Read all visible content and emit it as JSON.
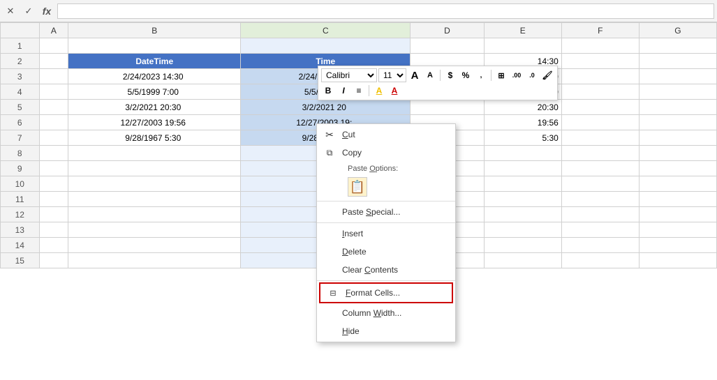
{
  "formulaBar": {
    "cancelLabel": "✕",
    "confirmLabel": "✓",
    "functionLabel": "fx"
  },
  "columns": {
    "headers": [
      "",
      "A",
      "B",
      "C",
      "D",
      "E",
      "F",
      "G"
    ]
  },
  "rows": [
    {
      "num": "1",
      "b": "",
      "c": "",
      "d": "",
      "e": "",
      "f": "",
      "g": ""
    },
    {
      "num": "2",
      "b": "DateTime",
      "c": "Time",
      "d": "",
      "e": "14:30",
      "f": "",
      "g": ""
    },
    {
      "num": "3",
      "b": "2/24/2023 14:30",
      "c": "2/24/2023 14:",
      "d": "",
      "e": "14:30",
      "f": "",
      "g": ""
    },
    {
      "num": "4",
      "b": "5/5/1999 7:00",
      "c": "5/5/1999 7",
      "d": "",
      "e": "7:00",
      "f": "",
      "g": ""
    },
    {
      "num": "5",
      "b": "3/2/2021 20:30",
      "c": "3/2/2021 20",
      "d": "",
      "e": "20:30",
      "f": "",
      "g": ""
    },
    {
      "num": "6",
      "b": "12/27/2003 19:56",
      "c": "12/27/2003 19:",
      "d": "",
      "e": "19:56",
      "f": "",
      "g": ""
    },
    {
      "num": "7",
      "b": "9/28/1967 5:30",
      "c": "9/28/1967 5",
      "d": "",
      "e": "5:30",
      "f": "",
      "g": ""
    },
    {
      "num": "8",
      "b": "",
      "c": "",
      "d": "",
      "e": "",
      "f": "",
      "g": ""
    },
    {
      "num": "9",
      "b": "",
      "c": "",
      "d": "",
      "e": "",
      "f": "",
      "g": ""
    },
    {
      "num": "10",
      "b": "",
      "c": "",
      "d": "",
      "e": "",
      "f": "",
      "g": ""
    },
    {
      "num": "11",
      "b": "",
      "c": "",
      "d": "",
      "e": "",
      "f": "",
      "g": ""
    },
    {
      "num": "12",
      "b": "",
      "c": "",
      "d": "",
      "e": "",
      "f": "",
      "g": ""
    },
    {
      "num": "13",
      "b": "",
      "c": "",
      "d": "",
      "e": "",
      "f": "",
      "g": ""
    },
    {
      "num": "14",
      "b": "",
      "c": "",
      "d": "",
      "e": "",
      "f": "",
      "g": ""
    },
    {
      "num": "15",
      "b": "",
      "c": "",
      "d": "",
      "e": "",
      "f": "",
      "g": ""
    }
  ],
  "miniToolbar": {
    "fontFamily": "Calibri",
    "fontSize": "11",
    "boldLabel": "B",
    "italicLabel": "I",
    "alignLabel": "≡",
    "highlightLabel": "A",
    "fontColorLabel": "A",
    "borderLabel": "⊞",
    "percentLabel": "%",
    "commaLabel": ",",
    "increaseDecimalLabel": "←.0",
    "decreaseDecimalLabel": ".00→",
    "paintLabel": "🖌"
  },
  "contextMenu": {
    "items": [
      {
        "id": "cut",
        "icon": "✂",
        "label": "Cut",
        "underline": 1,
        "disabled": false
      },
      {
        "id": "copy",
        "icon": "⧉",
        "label": "Copy",
        "underline": 0,
        "disabled": false
      },
      {
        "id": "paste-options",
        "icon": "",
        "label": "Paste Options:",
        "disabled": false,
        "isPasteHeader": true
      },
      {
        "id": "paste-special",
        "icon": "",
        "label": "Paste Special...",
        "underline": 0,
        "disabled": false
      },
      {
        "id": "insert",
        "icon": "",
        "label": "Insert",
        "underline": 0,
        "disabled": false
      },
      {
        "id": "delete",
        "icon": "",
        "label": "Delete",
        "underline": 0,
        "disabled": false
      },
      {
        "id": "clear-contents",
        "icon": "",
        "label": "Clear Contents",
        "underline": 0,
        "disabled": false
      },
      {
        "id": "format-cells",
        "icon": "⊟",
        "label": "Format Cells...",
        "underline": 7,
        "disabled": false,
        "highlighted": true
      },
      {
        "id": "column-width",
        "icon": "",
        "label": "Column Width...",
        "underline": 0,
        "disabled": false
      },
      {
        "id": "hide",
        "icon": "",
        "label": "Hide",
        "underline": 0,
        "disabled": false
      }
    ]
  }
}
